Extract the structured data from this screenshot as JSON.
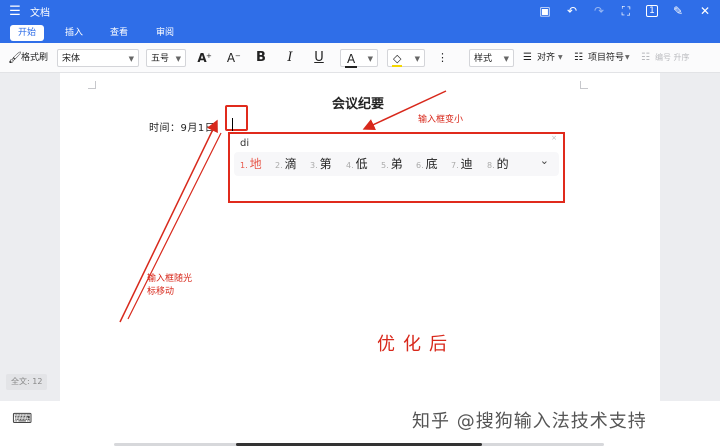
{
  "app": {
    "title": "文档"
  },
  "tabs": [
    {
      "label": "开始",
      "active": true
    },
    {
      "label": "插入",
      "active": false
    },
    {
      "label": "查看",
      "active": false
    },
    {
      "label": "审阅",
      "active": false
    }
  ],
  "toolbar": {
    "format_painter": "格式刷",
    "font_family": "宋体",
    "font_size": "五号",
    "grow_font": "A",
    "shrink_font": "A",
    "bold": "B",
    "italic": "I",
    "underline": "U",
    "font_color": "A",
    "styles": "样式",
    "align": "对齐",
    "bullets": "项目符号",
    "numbering": "编号 升序"
  },
  "document": {
    "title": "会议纪要",
    "line": "时间：9月1日"
  },
  "ime": {
    "pinyin": "di",
    "candidates": [
      {
        "num": "1.",
        "char": "地"
      },
      {
        "num": "2.",
        "char": "滴"
      },
      {
        "num": "3.",
        "char": "第"
      },
      {
        "num": "4.",
        "char": "低"
      },
      {
        "num": "5.",
        "char": "弟"
      },
      {
        "num": "6.",
        "char": "底"
      },
      {
        "num": "7.",
        "char": "迪"
      },
      {
        "num": "8.",
        "char": "的"
      }
    ],
    "close": "×"
  },
  "annotations": {
    "box_shrink": "输入框变小",
    "follow_1": "输入框随光",
    "follow_2": "标移动",
    "optimized": "优化后"
  },
  "status": {
    "word_count": "全文: 12"
  },
  "watermark": "知乎 @搜狗输入法技术支持",
  "colors": {
    "accent": "#2f6ee8",
    "annotation": "#e02a1c"
  }
}
